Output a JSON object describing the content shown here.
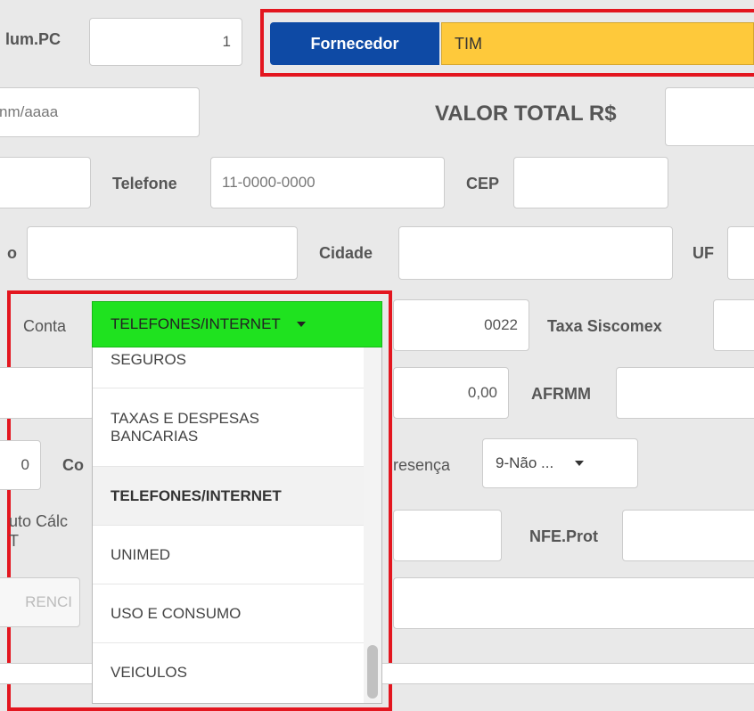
{
  "row1": {
    "vol_label": "lum.PC",
    "vol_value": "1",
    "fornecedor_label": "Fornecedor",
    "fornecedor_value": "TIM"
  },
  "row2": {
    "date_placeholder": "nm/aaaa",
    "valor_total_label": "VALOR TOTAL R$"
  },
  "row3": {
    "telefone_label": "Telefone",
    "telefone_placeholder": "11-0000-0000",
    "cep_label": "CEP"
  },
  "row4": {
    "partial_label": "o",
    "cidade_label": "Cidade",
    "uf_label": "UF"
  },
  "row5": {
    "conta_label": "Conta",
    "conta_selected": "TELEFONES/INTERNET",
    "code_value": "0022",
    "taxa_label": "Taxa Siscomex"
  },
  "row6": {
    "amount_value": "0,00",
    "afrmm_label": "AFRMM"
  },
  "row7": {
    "left_value": "0",
    "co_label": "Co",
    "presenca_label": "resença",
    "presenca_value": "9-Não ..."
  },
  "row8": {
    "auto_label_line1": "uto Cálc",
    "auto_label_line2": "T",
    "nfe_label": "NFE.Prot"
  },
  "row9": {
    "button_text": "RENCI"
  },
  "dropdown": {
    "items": [
      "SEGUROS",
      "TAXAS E DESPESAS BANCARIAS",
      "TELEFONES/INTERNET",
      "UNIMED",
      "USO E CONSUMO",
      "VEICULOS"
    ],
    "selected_index": 2
  },
  "colors": {
    "highlight_red": "#e3161f",
    "fornecedor_blue": "#0e4aa5",
    "fornecedor_yellow": "#fec93b",
    "select_green": "#1fe21f"
  }
}
